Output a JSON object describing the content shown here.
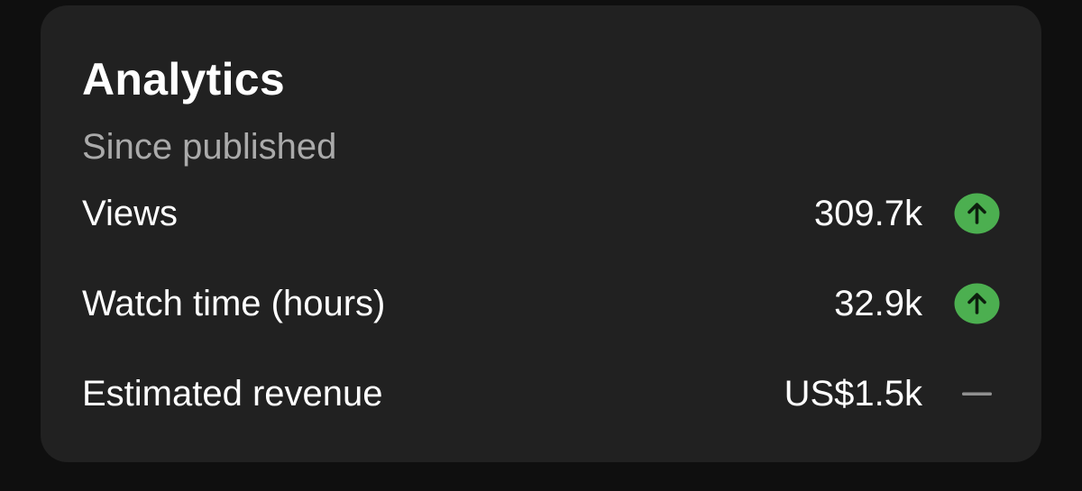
{
  "analytics": {
    "title": "Analytics",
    "subtitle": "Since published",
    "rows": [
      {
        "label": "Views",
        "value": "309.7k",
        "trend": "up-arrow-icon"
      },
      {
        "label": "Watch time (hours)",
        "value": "32.9k",
        "trend": "up-arrow-icon"
      },
      {
        "label": "Estimated revenue",
        "value": "US$1.5k",
        "trend": "dash-icon"
      }
    ]
  },
  "colors": {
    "background": "#0f0f0f",
    "card": "#212121",
    "text_primary": "#ffffff",
    "text_secondary": "#aaaaaa",
    "trend_up": "#4caf50",
    "trend_neutral": "#909090"
  }
}
